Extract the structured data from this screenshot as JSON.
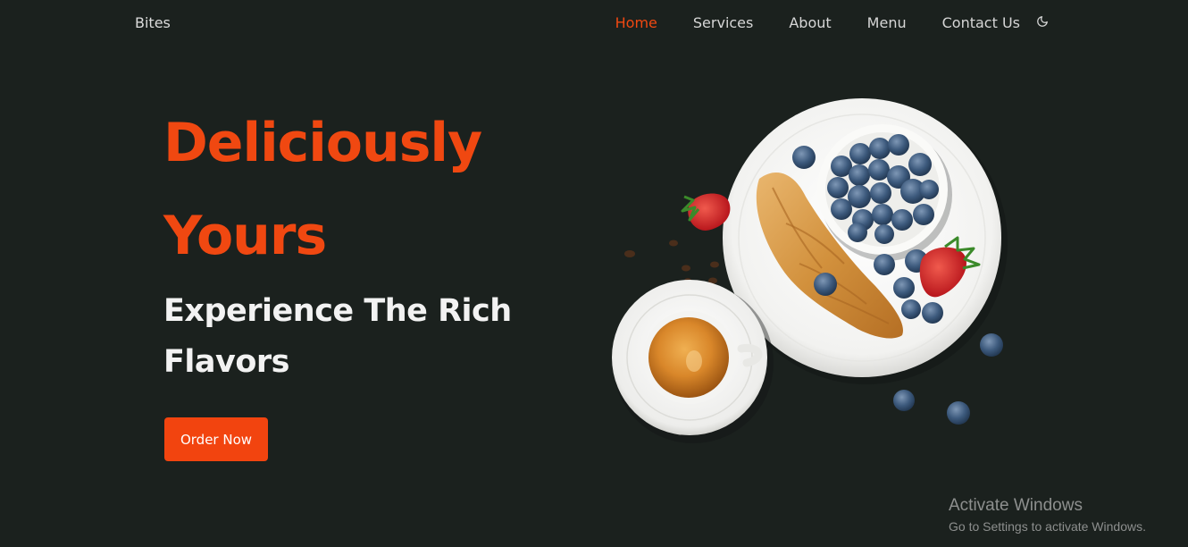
{
  "navbar": {
    "brand": "Bites",
    "links": [
      {
        "label": "Home",
        "active": true
      },
      {
        "label": "Services",
        "active": false
      },
      {
        "label": "About",
        "active": false
      },
      {
        "label": "Menu",
        "active": false
      },
      {
        "label": "Contact Us",
        "active": false
      }
    ],
    "theme_toggle_icon": "moon-icon"
  },
  "hero": {
    "title_line1": "Deliciously",
    "title_line2": "Yours",
    "subtitle": "Experience The Rich Flavors",
    "cta_label": "Order Now"
  },
  "illustration": {
    "subject": "croissant-coffee-blueberries-image"
  },
  "watermark": {
    "title": "Activate Windows",
    "subtitle": "Go to Settings to activate Windows."
  },
  "colors": {
    "background": "#1b211e",
    "accent": "#f04811",
    "text": "#f2f2f2",
    "nav_text": "#d6d6d6"
  }
}
